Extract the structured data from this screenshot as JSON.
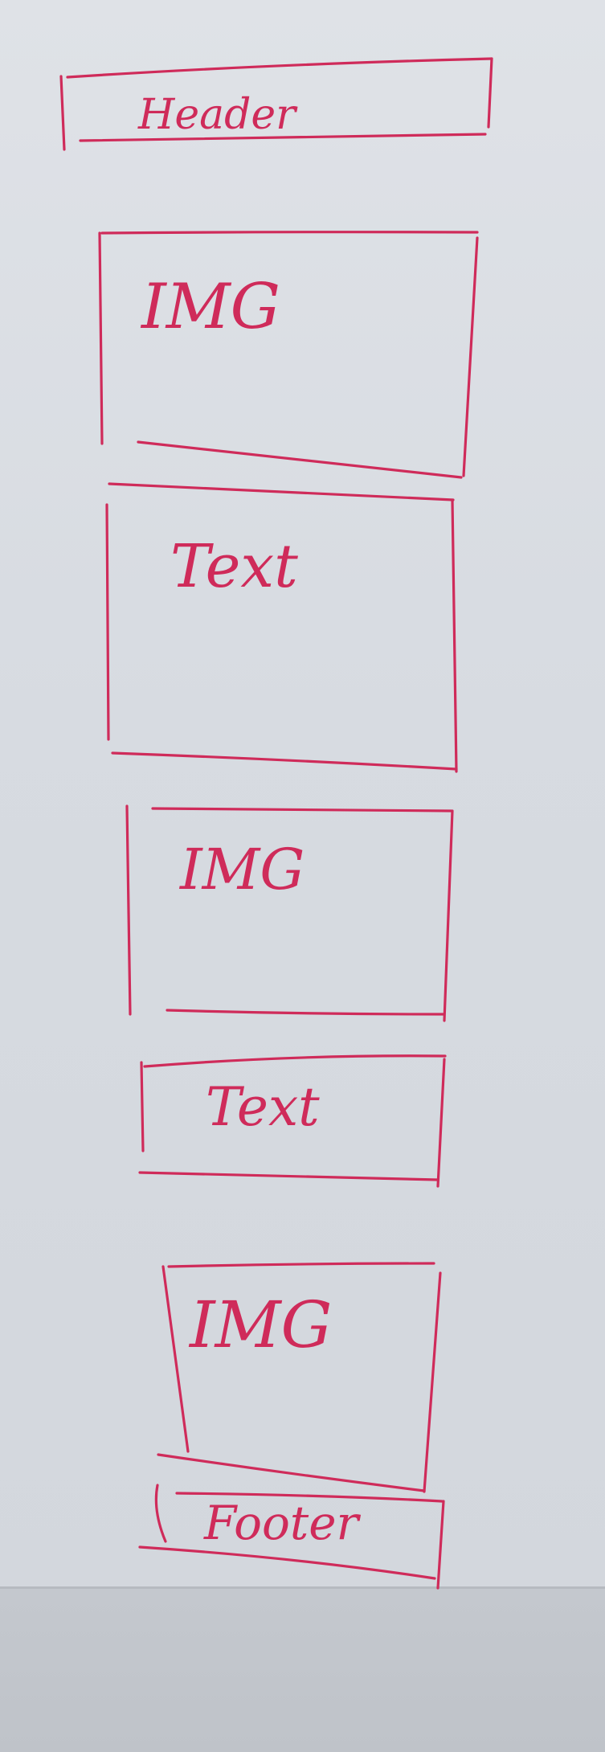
{
  "wireframe": {
    "header": {
      "label": "Header"
    },
    "blocks": [
      {
        "kind": "image",
        "label": "IMG"
      },
      {
        "kind": "text",
        "label": "Text"
      },
      {
        "kind": "image",
        "label": "IMG"
      },
      {
        "kind": "text",
        "label": "Text"
      },
      {
        "kind": "image",
        "label": "IMG"
      }
    ],
    "footer": {
      "label": "Footer"
    }
  },
  "colors": {
    "ink": "#cf2b5a",
    "paper": "#dfe2e7",
    "desk": "#c4c8ce"
  }
}
